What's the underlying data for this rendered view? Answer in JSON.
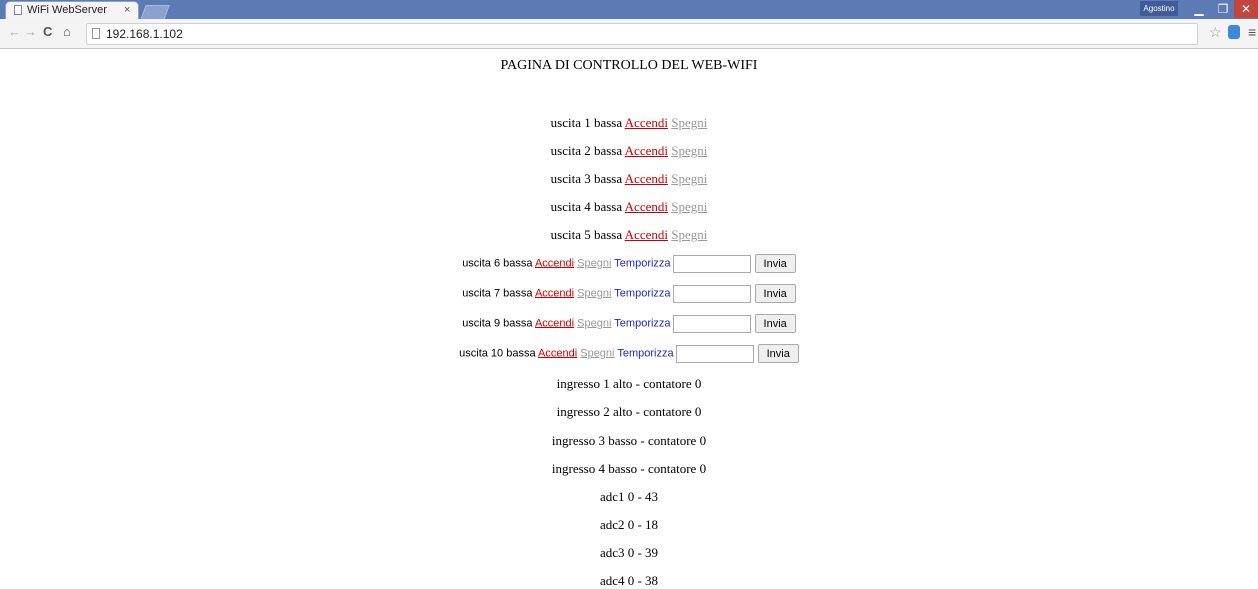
{
  "browser": {
    "tab_title": "WiFi WebServer",
    "tab_close": "×",
    "user": "Agostino",
    "url": "192.168.1.102",
    "min_glyph": "▁",
    "max_glyph": "❐",
    "close_glyph": "✕"
  },
  "page": {
    "heading": "PAGINA DI CONTROLLO DEL WEB-WIFI",
    "outputs": [
      {
        "label": "uscita 1 bassa",
        "on": "Accendi",
        "off": "Spegni"
      },
      {
        "label": "uscita 2 bassa",
        "on": "Accendi",
        "off": "Spegni"
      },
      {
        "label": "uscita 3 bassa",
        "on": "Accendi",
        "off": "Spegni"
      },
      {
        "label": "uscita 4 bassa",
        "on": "Accendi",
        "off": "Spegni"
      },
      {
        "label": "uscita 5 bassa",
        "on": "Accendi",
        "off": "Spegni"
      }
    ],
    "timed_outputs": [
      {
        "label": "uscita 6 bassa",
        "on": "Accendi",
        "off": "Spegni",
        "timer": "Temporizza",
        "value": "",
        "submit": "Invia"
      },
      {
        "label": "uscita 7 bassa",
        "on": "Accendi",
        "off": "Spegni",
        "timer": "Temporizza",
        "value": "",
        "submit": "Invia"
      },
      {
        "label": "uscita 9 bassa",
        "on": "Accendi",
        "off": "Spegni",
        "timer": "Temporizza",
        "value": "",
        "submit": "Invia"
      },
      {
        "label": "uscita 10 bassa",
        "on": "Accendi",
        "off": "Spegni",
        "timer": "Temporizza",
        "value": "",
        "submit": "Invia"
      }
    ],
    "inputs": [
      "ingresso 1 alto - contatore 0",
      "ingresso 2 alto - contatore 0",
      "ingresso 3 basso - contatore 0",
      "ingresso 4 basso - contatore 0"
    ],
    "adc": [
      "adc1 0 - 43",
      "adc2 0 - 18",
      "adc3 0 - 39",
      "adc4 0 - 38"
    ]
  },
  "colors": {
    "on_link": "#cc0000",
    "off_link": "#999999",
    "timer_link": "#1a2bb5",
    "titlebar": "#5e7ab5"
  }
}
